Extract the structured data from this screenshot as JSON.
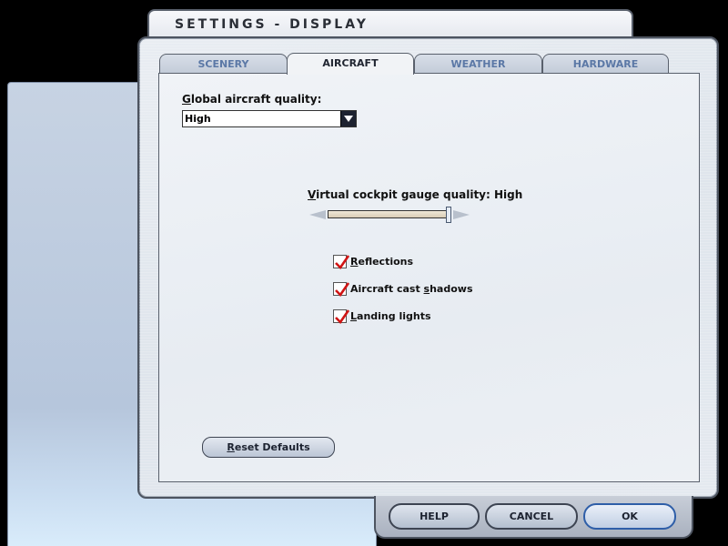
{
  "window": {
    "title": "SETTINGS - DISPLAY"
  },
  "tabs": [
    {
      "label": "SCENERY",
      "active": false
    },
    {
      "label": "AIRCRAFT",
      "active": true
    },
    {
      "label": "WEATHER",
      "active": false
    },
    {
      "label": "HARDWARE",
      "active": false
    }
  ],
  "aircraft": {
    "quality_label_underlined": "G",
    "quality_label_rest": "lobal aircraft quality:",
    "quality_value": "High",
    "gauge_label_underlined": "V",
    "gauge_label_rest": "irtual cockpit gauge quality: High",
    "gauge_level_fraction": 1.0,
    "checkboxes": [
      {
        "u": "R",
        "rest": "eflections",
        "checked": true
      },
      {
        "u": "",
        "pre": "Aircraft cast ",
        "u2": "s",
        "rest2": "hadows",
        "checked": true
      },
      {
        "u": "L",
        "rest": "anding lights",
        "checked": true
      }
    ],
    "reset_u": "R",
    "reset_rest": "eset Defaults"
  },
  "buttons": {
    "help": "HELP",
    "cancel": "CANCEL",
    "ok": "OK"
  },
  "colors": {
    "check_mark": "#d01414",
    "accent_blue": "#2e5ea8"
  }
}
